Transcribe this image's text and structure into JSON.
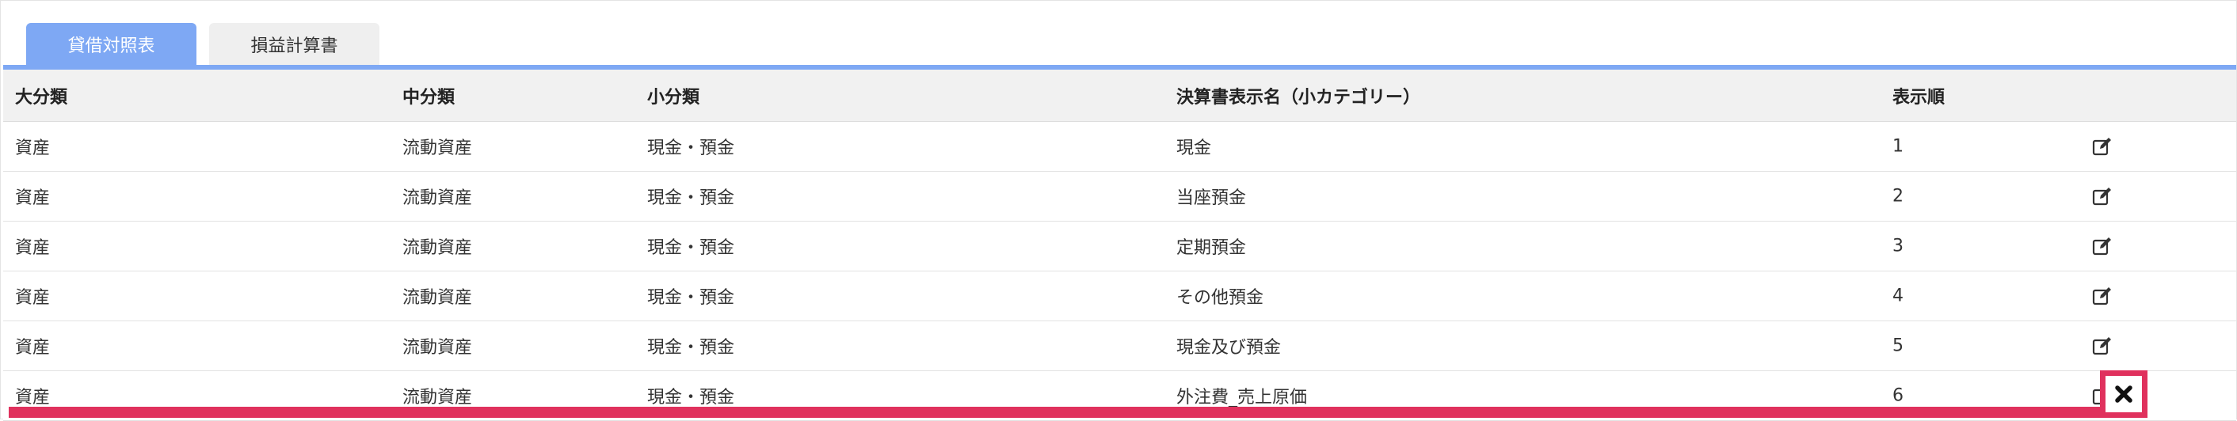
{
  "tabs": [
    {
      "label": "貸借対照表",
      "active": true
    },
    {
      "label": "損益計算書",
      "active": false
    }
  ],
  "table": {
    "headers": [
      "大分類",
      "中分類",
      "小分類",
      "決算書表示名（小カテゴリー）",
      "表示順"
    ],
    "rows": [
      [
        "資産",
        "流動資産",
        "現金・預金",
        "現金",
        "1"
      ],
      [
        "資産",
        "流動資産",
        "現金・預金",
        "当座預金",
        "2"
      ],
      [
        "資産",
        "流動資産",
        "現金・預金",
        "定期預金",
        "3"
      ],
      [
        "資産",
        "流動資産",
        "現金・預金",
        "その他預金",
        "4"
      ],
      [
        "資産",
        "流動資産",
        "現金・預金",
        "現金及び預金",
        "5"
      ],
      [
        "資産",
        "流動資産",
        "現金・預金",
        "外注費_売上原価",
        "6"
      ]
    ]
  },
  "icons": {
    "edit": "edit-icon",
    "delete": "close-icon"
  },
  "colors": {
    "accent": "#7ea8f4",
    "highlight": "#e0315d",
    "header_bg": "#f1f1f1"
  }
}
